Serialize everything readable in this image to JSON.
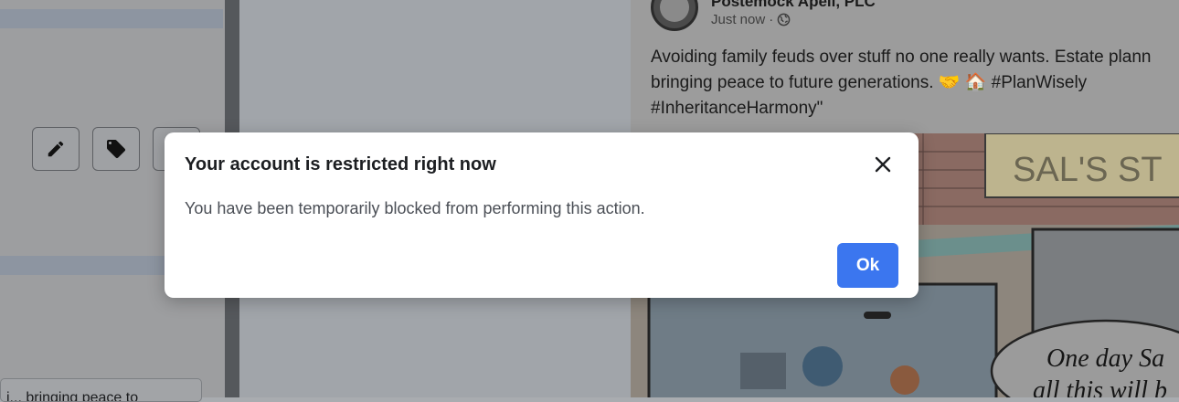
{
  "left_panel": {
    "tool_buttons": [
      {
        "icon": "pencil-icon"
      },
      {
        "icon": "tag-icon"
      },
      {
        "icon": "unknown-icon"
      }
    ],
    "bottom_field_text": "i... bringing peace to"
  },
  "post": {
    "author": "Postemock Apell, PLC",
    "timestamp": "Just now",
    "separator": "·",
    "privacy_icon": "globe-icon",
    "text": "Avoiding family feuds over stuff no one really wants. Estate plann\nbringing peace to future generations. 🤝 🏠 #PlanWisely\n#InheritanceHarmony\"",
    "image_sign_text": "SAL'S ST",
    "image_speech_text": "One day Sa\nall this will b"
  },
  "dialog": {
    "title": "Your account is restricted right now",
    "message": "You have been temporarily blocked from performing this action.",
    "ok_label": "Ok",
    "close_icon": "close-icon"
  },
  "colors": {
    "dialog_button": "#3b76ef",
    "backdrop": "#000000"
  }
}
